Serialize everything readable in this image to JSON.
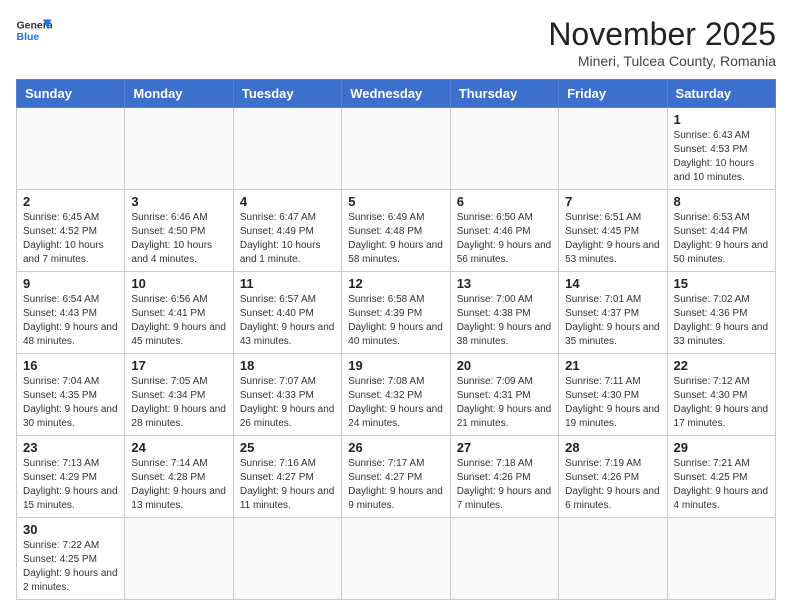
{
  "header": {
    "logo_general": "General",
    "logo_blue": "Blue",
    "month_title": "November 2025",
    "subtitle": "Mineri, Tulcea County, Romania"
  },
  "weekdays": [
    "Sunday",
    "Monday",
    "Tuesday",
    "Wednesday",
    "Thursday",
    "Friday",
    "Saturday"
  ],
  "weeks": [
    [
      {
        "day": "",
        "info": ""
      },
      {
        "day": "",
        "info": ""
      },
      {
        "day": "",
        "info": ""
      },
      {
        "day": "",
        "info": ""
      },
      {
        "day": "",
        "info": ""
      },
      {
        "day": "",
        "info": ""
      },
      {
        "day": "1",
        "info": "Sunrise: 6:43 AM\nSunset: 4:53 PM\nDaylight: 10 hours and 10 minutes."
      }
    ],
    [
      {
        "day": "2",
        "info": "Sunrise: 6:45 AM\nSunset: 4:52 PM\nDaylight: 10 hours and 7 minutes."
      },
      {
        "day": "3",
        "info": "Sunrise: 6:46 AM\nSunset: 4:50 PM\nDaylight: 10 hours and 4 minutes."
      },
      {
        "day": "4",
        "info": "Sunrise: 6:47 AM\nSunset: 4:49 PM\nDaylight: 10 hours and 1 minute."
      },
      {
        "day": "5",
        "info": "Sunrise: 6:49 AM\nSunset: 4:48 PM\nDaylight: 9 hours and 58 minutes."
      },
      {
        "day": "6",
        "info": "Sunrise: 6:50 AM\nSunset: 4:46 PM\nDaylight: 9 hours and 56 minutes."
      },
      {
        "day": "7",
        "info": "Sunrise: 6:51 AM\nSunset: 4:45 PM\nDaylight: 9 hours and 53 minutes."
      },
      {
        "day": "8",
        "info": "Sunrise: 6:53 AM\nSunset: 4:44 PM\nDaylight: 9 hours and 50 minutes."
      }
    ],
    [
      {
        "day": "9",
        "info": "Sunrise: 6:54 AM\nSunset: 4:43 PM\nDaylight: 9 hours and 48 minutes."
      },
      {
        "day": "10",
        "info": "Sunrise: 6:56 AM\nSunset: 4:41 PM\nDaylight: 9 hours and 45 minutes."
      },
      {
        "day": "11",
        "info": "Sunrise: 6:57 AM\nSunset: 4:40 PM\nDaylight: 9 hours and 43 minutes."
      },
      {
        "day": "12",
        "info": "Sunrise: 6:58 AM\nSunset: 4:39 PM\nDaylight: 9 hours and 40 minutes."
      },
      {
        "day": "13",
        "info": "Sunrise: 7:00 AM\nSunset: 4:38 PM\nDaylight: 9 hours and 38 minutes."
      },
      {
        "day": "14",
        "info": "Sunrise: 7:01 AM\nSunset: 4:37 PM\nDaylight: 9 hours and 35 minutes."
      },
      {
        "day": "15",
        "info": "Sunrise: 7:02 AM\nSunset: 4:36 PM\nDaylight: 9 hours and 33 minutes."
      }
    ],
    [
      {
        "day": "16",
        "info": "Sunrise: 7:04 AM\nSunset: 4:35 PM\nDaylight: 9 hours and 30 minutes."
      },
      {
        "day": "17",
        "info": "Sunrise: 7:05 AM\nSunset: 4:34 PM\nDaylight: 9 hours and 28 minutes."
      },
      {
        "day": "18",
        "info": "Sunrise: 7:07 AM\nSunset: 4:33 PM\nDaylight: 9 hours and 26 minutes."
      },
      {
        "day": "19",
        "info": "Sunrise: 7:08 AM\nSunset: 4:32 PM\nDaylight: 9 hours and 24 minutes."
      },
      {
        "day": "20",
        "info": "Sunrise: 7:09 AM\nSunset: 4:31 PM\nDaylight: 9 hours and 21 minutes."
      },
      {
        "day": "21",
        "info": "Sunrise: 7:11 AM\nSunset: 4:30 PM\nDaylight: 9 hours and 19 minutes."
      },
      {
        "day": "22",
        "info": "Sunrise: 7:12 AM\nSunset: 4:30 PM\nDaylight: 9 hours and 17 minutes."
      }
    ],
    [
      {
        "day": "23",
        "info": "Sunrise: 7:13 AM\nSunset: 4:29 PM\nDaylight: 9 hours and 15 minutes."
      },
      {
        "day": "24",
        "info": "Sunrise: 7:14 AM\nSunset: 4:28 PM\nDaylight: 9 hours and 13 minutes."
      },
      {
        "day": "25",
        "info": "Sunrise: 7:16 AM\nSunset: 4:27 PM\nDaylight: 9 hours and 11 minutes."
      },
      {
        "day": "26",
        "info": "Sunrise: 7:17 AM\nSunset: 4:27 PM\nDaylight: 9 hours and 9 minutes."
      },
      {
        "day": "27",
        "info": "Sunrise: 7:18 AM\nSunset: 4:26 PM\nDaylight: 9 hours and 7 minutes."
      },
      {
        "day": "28",
        "info": "Sunrise: 7:19 AM\nSunset: 4:26 PM\nDaylight: 9 hours and 6 minutes."
      },
      {
        "day": "29",
        "info": "Sunrise: 7:21 AM\nSunset: 4:25 PM\nDaylight: 9 hours and 4 minutes."
      }
    ],
    [
      {
        "day": "30",
        "info": "Sunrise: 7:22 AM\nSunset: 4:25 PM\nDaylight: 9 hours and 2 minutes."
      },
      {
        "day": "",
        "info": ""
      },
      {
        "day": "",
        "info": ""
      },
      {
        "day": "",
        "info": ""
      },
      {
        "day": "",
        "info": ""
      },
      {
        "day": "",
        "info": ""
      },
      {
        "day": "",
        "info": ""
      }
    ]
  ]
}
